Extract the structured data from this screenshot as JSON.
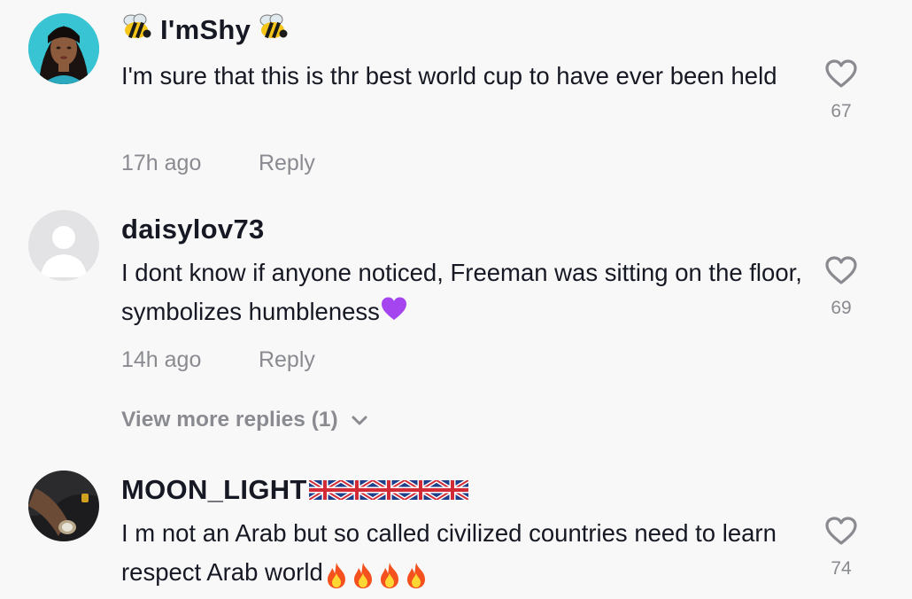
{
  "comments": [
    {
      "username": "I'mShy",
      "text": "I'm sure that this is thr best world cup to have ever been held",
      "time": "17h ago",
      "reply_label": "Reply",
      "likes": "67",
      "avatar": "woman-portrait-avatar"
    },
    {
      "username": "daisylov73",
      "text": "I dont know if anyone noticed, Freeman was sitting on the floor, symbolizes humbleness",
      "time": "14h ago",
      "reply_label": "Reply",
      "likes": "69",
      "avatar": "default-person-avatar"
    },
    {
      "username": "MOON_LIGHT",
      "text": "I m not an Arab but so called civilized countries need to learn respect Arab world",
      "likes": "74",
      "avatar": "watch-wrist-avatar"
    }
  ],
  "view_more": {
    "label": "View more replies (1)"
  },
  "icons": {
    "like": "heart-outline-icon",
    "expand": "chevron-down-icon",
    "bee": "bee-emoji",
    "heart_emoji": "purple-heart-emoji",
    "flag": "uk-flag-emoji",
    "fire": "fire-emoji"
  },
  "colors": {
    "text": "#161823",
    "muted": "#8a8b91",
    "background": "#f8f8f8",
    "purple_heart": "#a445f0"
  }
}
